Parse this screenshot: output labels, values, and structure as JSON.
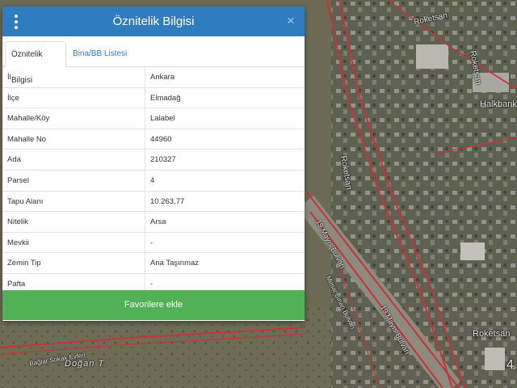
{
  "panel": {
    "title": "Öznitelik Bilgisi",
    "menu_icon": "vertical-dots-icon",
    "close_glyph": "×",
    "tabs": [
      {
        "label": "Öznitelik Bilgisi",
        "active": true
      },
      {
        "label": "Bina/BB Listesi",
        "active": false
      }
    ],
    "rows": [
      {
        "key": "İl",
        "value": "Ankara"
      },
      {
        "key": "İlçe",
        "value": "Elmadağ"
      },
      {
        "key": "Mahalle/Köy",
        "value": "Lalabel"
      },
      {
        "key": "Mahalle No",
        "value": "44960"
      },
      {
        "key": "Ada",
        "value": "210327"
      },
      {
        "key": "Parsel",
        "value": "4"
      },
      {
        "key": "Tapu Alanı",
        "value": "10.263,77"
      },
      {
        "key": "Nitelik",
        "value": "Arsa"
      },
      {
        "key": "Mevkii",
        "value": "-"
      },
      {
        "key": "Zemin Tip",
        "value": "Ana Taşınmaz"
      },
      {
        "key": "Pafta",
        "value": "-"
      }
    ],
    "favorite_button": "Favorilere ekle"
  },
  "map": {
    "labels": {
      "roketsan_top": "Roketsan",
      "roketsan_right": "Roketsan",
      "halkbank": "Halkbank",
      "roketsan_mid": "Roketsan",
      "road_1": "19 Mayıs Bulvarı",
      "road_2": "19 Mayıs Bulvarı",
      "street": "Mimar Sinan Bulvarı",
      "roketsan_bottom": "Roketsan",
      "baglar": "Bağlar Sokak Evleri",
      "dogan": "Doğan T.",
      "corner": "4"
    }
  },
  "colors": {
    "header": "#2f7cc0",
    "favorite_button": "#52b156",
    "tab_link": "#2f7cc0",
    "road": "#c8323a"
  }
}
